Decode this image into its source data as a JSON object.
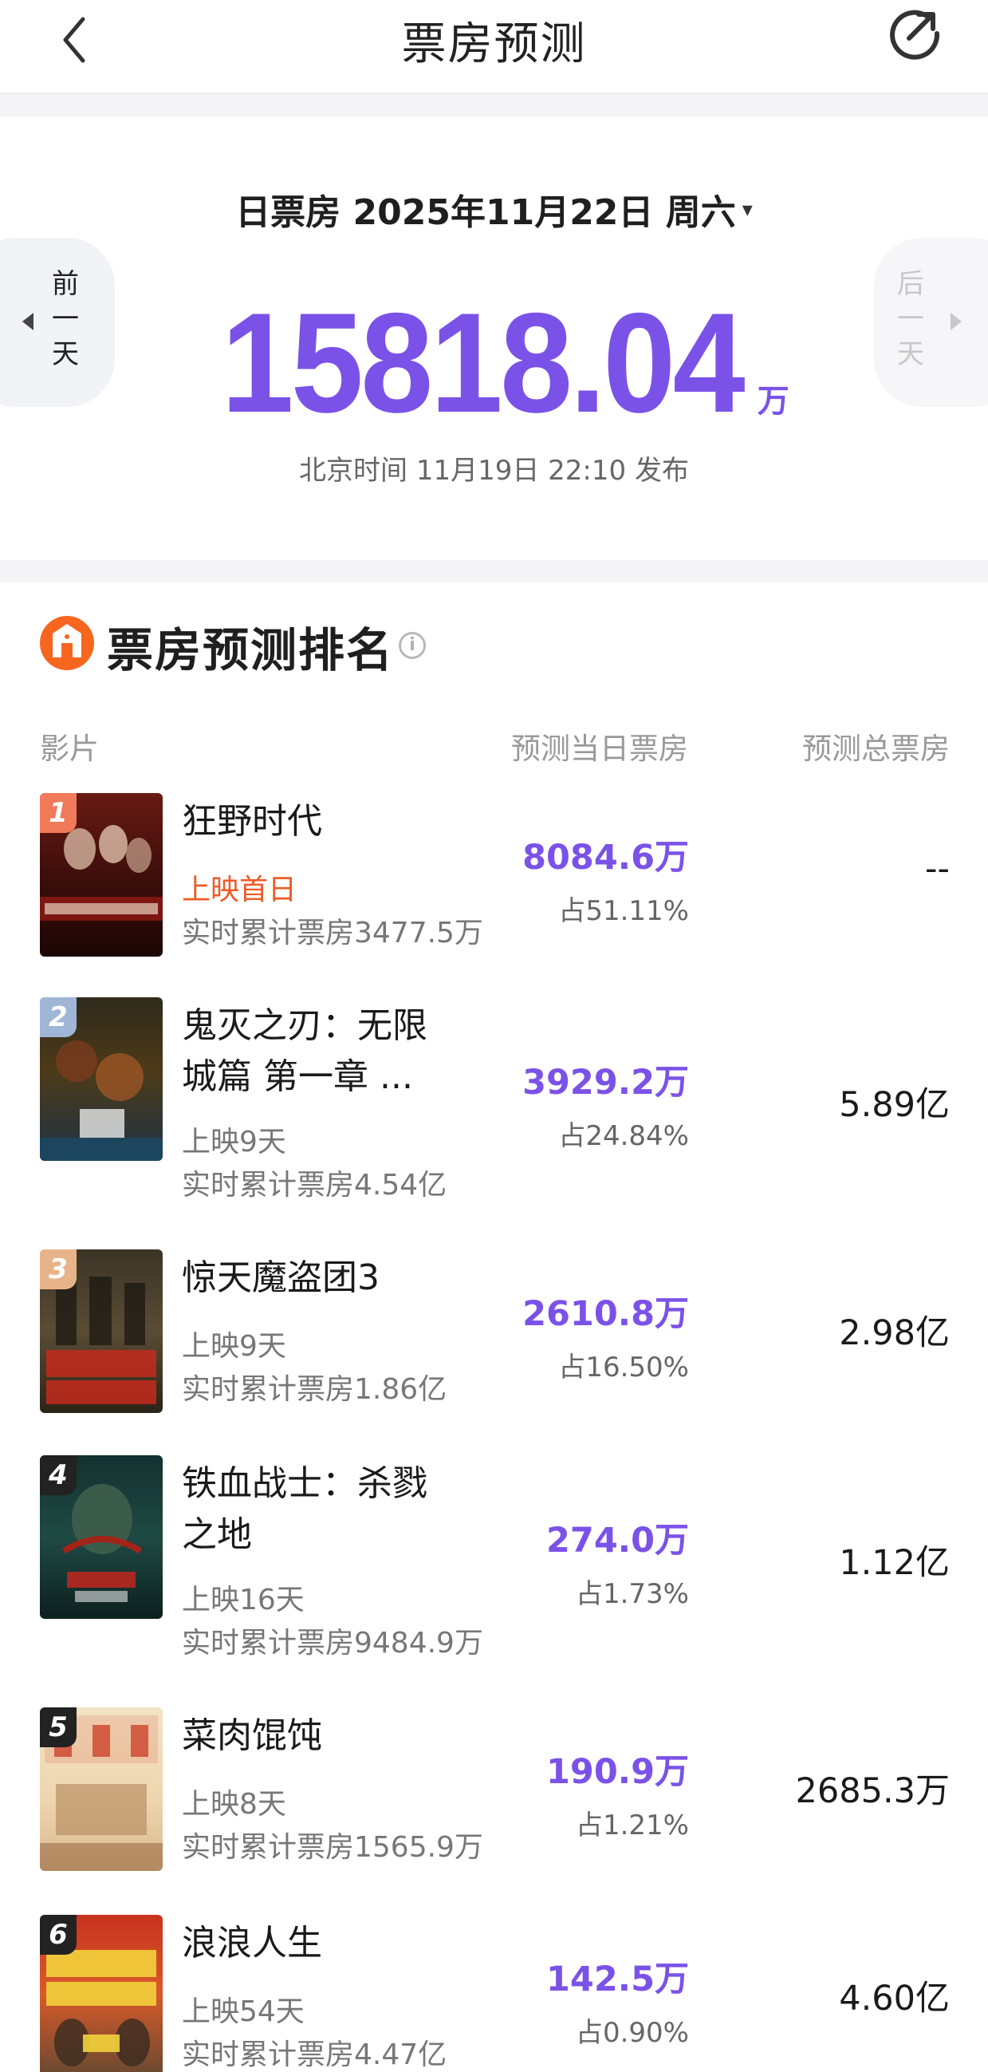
{
  "nav": {
    "title": "票房预测"
  },
  "daily": {
    "date_label": "日票房 2025年11月22日 周六",
    "caret": "▾",
    "prev_label": "前一天",
    "next_label": "后一天",
    "value": "15818.04",
    "unit": "万",
    "published": "北京时间 11月19日 22:10 发布"
  },
  "ranking": {
    "title": "票房预测排名",
    "info_glyph": "i",
    "columns": {
      "film": "影片",
      "daily": "预测当日票房",
      "total": "预测总票房"
    },
    "rows": [
      {
        "rank": "1",
        "name": "狂野时代",
        "release": "上映首日",
        "cumulative": "实时累计票房3477.5万",
        "daily": "8084.6万",
        "share": "占51.11%",
        "total": "--",
        "badge_color": "#f07a5a"
      },
      {
        "rank": "2",
        "name": "鬼灭之刃：无限城篇 第一章 ...",
        "release": "上映9天",
        "cumulative": "实时累计票房4.54亿",
        "daily": "3929.2万",
        "share": "占24.84%",
        "total": "5.89亿",
        "badge_color": "#9fb6d6"
      },
      {
        "rank": "3",
        "name": "惊天魔盗团3",
        "release": "上映9天",
        "cumulative": "实时累计票房1.86亿",
        "daily": "2610.8万",
        "share": "占16.50%",
        "total": "2.98亿",
        "badge_color": "#e7b48a"
      },
      {
        "rank": "4",
        "name": "铁血战士：杀戮之地",
        "release": "上映16天",
        "cumulative": "实时累计票房9484.9万",
        "daily": "274.0万",
        "share": "占1.73%",
        "total": "1.12亿",
        "badge_color": "#222222"
      },
      {
        "rank": "5",
        "name": "菜肉馄饨",
        "release": "上映8天",
        "cumulative": "实时累计票房1565.9万",
        "daily": "190.9万",
        "share": "占1.21%",
        "total": "2685.3万",
        "badge_color": "#222222"
      },
      {
        "rank": "6",
        "name": "浪浪人生",
        "release": "上映54天",
        "cumulative": "实时累计票房4.47亿",
        "daily": "142.5万",
        "share": "占0.90%",
        "total": "4.60亿",
        "badge_color": "#222222"
      }
    ]
  },
  "colors": {
    "accent": "#7b52e8",
    "first_day": "#ef5a26",
    "logo": "#f7661e"
  },
  "icons": {
    "back": "chevron-left-icon",
    "share": "refresh-share-icon",
    "logo": "film-logo-icon",
    "info": "info-icon"
  }
}
